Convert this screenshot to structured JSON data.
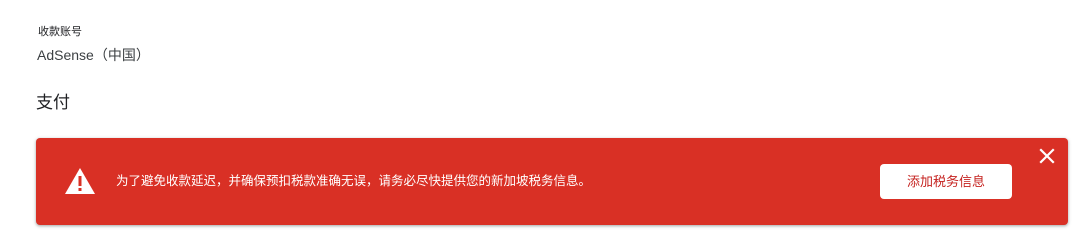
{
  "payee": {
    "label": "收款账号",
    "value": "AdSense（中国）"
  },
  "section": {
    "title": "支付"
  },
  "alert": {
    "message": "为了避免收款延迟，并确保预扣税款准确无误，请务必尽快提供您的新加坡税务信息。",
    "action_label": "添加税务信息",
    "background_color": "#d93025",
    "icon": "warning-icon",
    "close_icon": "close-icon"
  }
}
